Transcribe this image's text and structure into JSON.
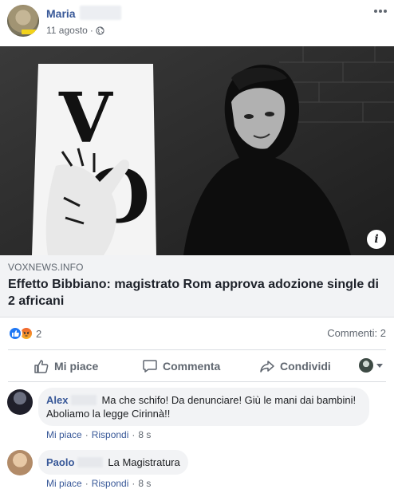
{
  "post": {
    "author": "Maria",
    "date": "11 agosto",
    "date_separator": "·",
    "image_letters": [
      "V",
      "O"
    ]
  },
  "link": {
    "domain": "VOXNEWS.INFO",
    "title": "Effetto Bibbiano: magistrato Rom approva adozione single di 2 africani"
  },
  "reactions": {
    "count": "2",
    "comments": "Commenti: 2",
    "icons": [
      "like-icon",
      "angry-icon"
    ],
    "colors": {
      "like": "#2078f4",
      "angry": "#f0612d"
    }
  },
  "actions": {
    "like": "Mi piace",
    "comment": "Commenta",
    "share": "Condividi"
  },
  "comments": [
    {
      "name": "Alex",
      "text_line1": "Ma che schifo! Da denunciare! Giù le mani dai bambini!",
      "text_line2": "Aboliamo la legge Cirinnà!!",
      "like": "Mi piace",
      "reply": "Rispondi",
      "time": "8 s",
      "sep": "·"
    },
    {
      "name": "Paolo",
      "text_line1": "La Magistratura",
      "like": "Mi piace",
      "reply": "Rispondi",
      "time": "8 s",
      "sep": "·"
    }
  ],
  "colors": {
    "link_blue": "#385898",
    "meta_gray": "#606770",
    "preview_bg": "#f2f3f5"
  }
}
